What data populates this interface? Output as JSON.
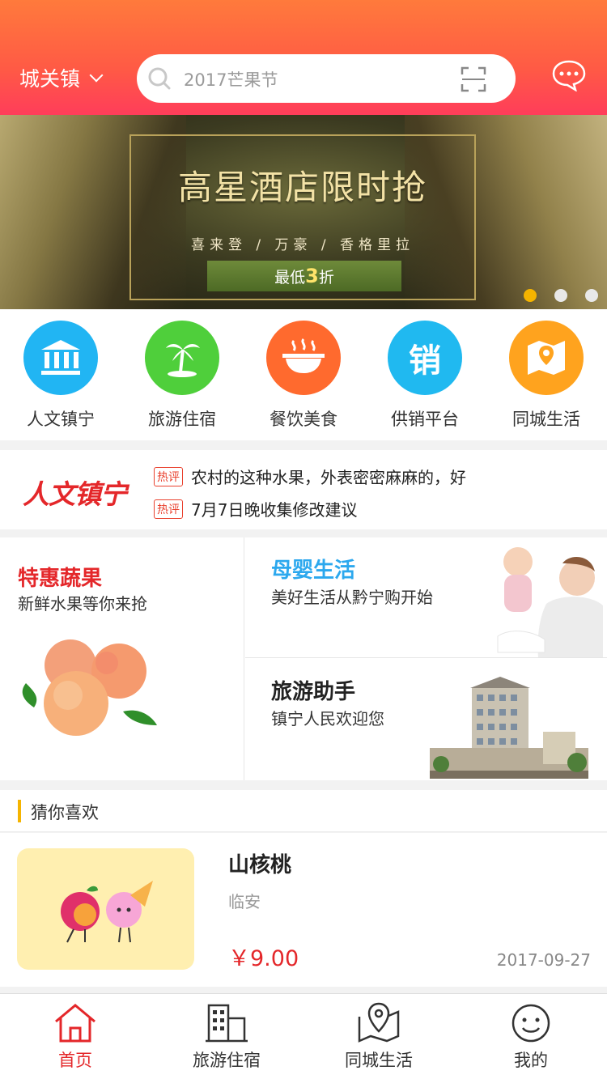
{
  "header": {
    "city": "城关镇",
    "search_placeholder": "2017芒果节"
  },
  "banner": {
    "title": "高星酒店限时抢",
    "subtitle": "喜来登 / 万豪 / 香格里拉",
    "ribbon_prefix": "最低",
    "ribbon_num": "3",
    "ribbon_suffix": "折"
  },
  "categories": [
    {
      "label": "人文镇宁",
      "icon": "bank-icon",
      "color": "#21b5f3"
    },
    {
      "label": "旅游住宿",
      "icon": "palm-tree-icon",
      "color": "#4fcf3b"
    },
    {
      "label": "餐饮美食",
      "icon": "bowl-icon",
      "color": "#ff6a2e"
    },
    {
      "label": "供销平台",
      "icon": "sale-icon",
      "color": "#20b9f0"
    },
    {
      "label": "同城生活",
      "icon": "map-icon",
      "color": "#ffa31e"
    }
  ],
  "news": {
    "brand": "人文镇宁",
    "tag": "热评",
    "items": [
      "农村的这种水果，外表密密麻麻的，好",
      "7月7日晚收集修改建议"
    ]
  },
  "features": {
    "fruit": {
      "title": "特惠蔬果",
      "sub": "新鲜水果等你来抢",
      "color": "#e4272a"
    },
    "baby": {
      "title": "母婴生活",
      "sub": "美好生活从黔宁购开始",
      "color": "#2ca8ee"
    },
    "travel": {
      "title": "旅游助手",
      "sub": "镇宁人民欢迎您",
      "color": "#222222"
    }
  },
  "guess": {
    "title": "猜你喜欢",
    "item": {
      "name": "山核桃",
      "location": "临安",
      "price": "￥9.00",
      "date": "2017-09-27"
    }
  },
  "tabbar": [
    {
      "label": "首页",
      "active": true
    },
    {
      "label": "旅游住宿",
      "active": false
    },
    {
      "label": "同城生活",
      "active": false
    },
    {
      "label": "我的",
      "active": false
    }
  ]
}
